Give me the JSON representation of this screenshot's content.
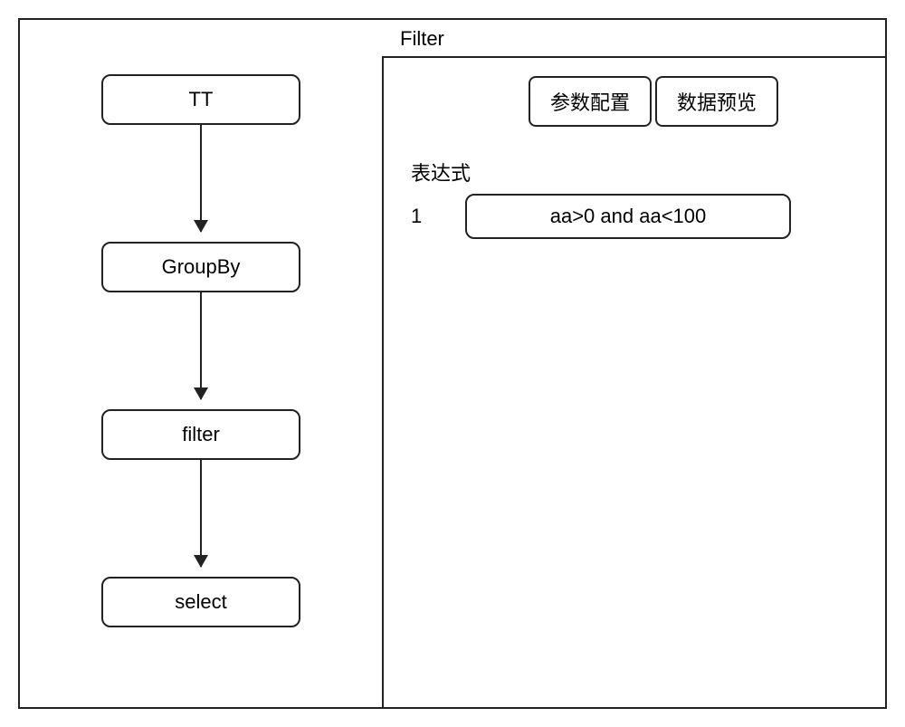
{
  "flow": {
    "nodes": [
      "TT",
      "GroupBy",
      "filter",
      "select"
    ]
  },
  "panel": {
    "title": "Filter",
    "tabs": [
      "参数配置",
      "数据预览"
    ],
    "section_label": "表达式",
    "expressions": [
      {
        "index": "1",
        "value": "aa>0 and  aa<100"
      }
    ]
  }
}
